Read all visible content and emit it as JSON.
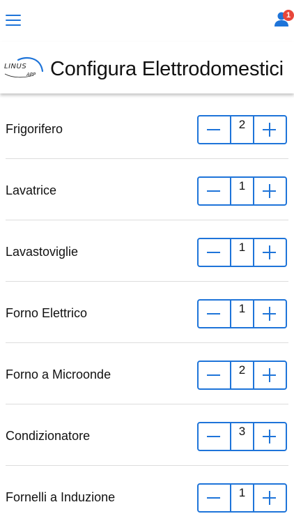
{
  "topbar": {
    "menu_icon": "hamburger-menu-icon",
    "user_icon": "user-icon",
    "notification_count": "1",
    "accent_color": "#1e74d9",
    "badge_color": "#e8463a"
  },
  "header": {
    "logo_text": "LINUS",
    "logo_subtext": "APP",
    "title": "Configura Elettrodomestici"
  },
  "appliances": [
    {
      "label": "Frigorifero",
      "value": "2"
    },
    {
      "label": "Lavatrice",
      "value": "1"
    },
    {
      "label": "Lavastoviglie",
      "value": "1"
    },
    {
      "label": "Forno Elettrico",
      "value": "1"
    },
    {
      "label": "Forno a Microonde",
      "value": "2"
    },
    {
      "label": "Condizionatore",
      "value": "3"
    },
    {
      "label": "Fornelli a Induzione",
      "value": "1"
    }
  ],
  "stepper": {
    "minus_icon": "minus-icon",
    "plus_icon": "plus-icon"
  }
}
